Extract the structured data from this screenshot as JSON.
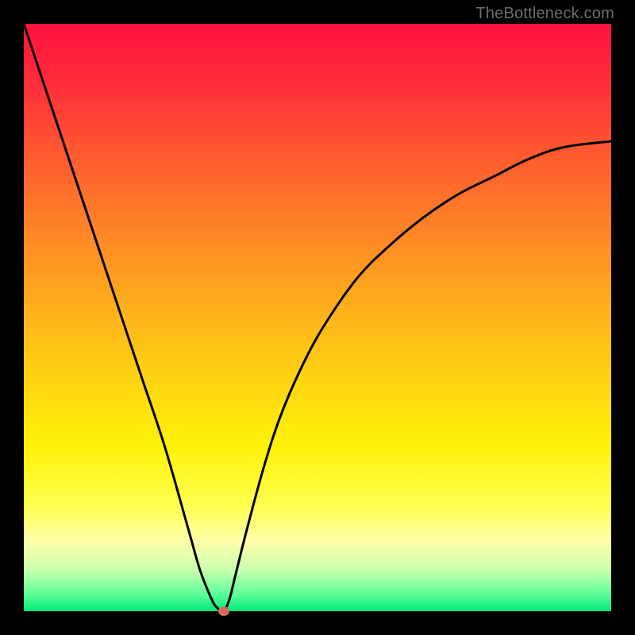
{
  "watermark": {
    "text": "TheBottleneck.com"
  },
  "chart_data": {
    "type": "line",
    "title": "",
    "xlabel": "",
    "ylabel": "",
    "xlim": [
      0,
      100
    ],
    "ylim": [
      0,
      100
    ],
    "grid": false,
    "legend": false,
    "background_gradient": {
      "stops": [
        {
          "offset": 0.0,
          "color": "#ff113f"
        },
        {
          "offset": 0.1,
          "color": "#ff2d3a"
        },
        {
          "offset": 0.22,
          "color": "#ff5930"
        },
        {
          "offset": 0.35,
          "color": "#ff8426"
        },
        {
          "offset": 0.48,
          "color": "#ffae1c"
        },
        {
          "offset": 0.6,
          "color": "#ffd212"
        },
        {
          "offset": 0.72,
          "color": "#fff208"
        },
        {
          "offset": 0.82,
          "color": "#ffff50"
        },
        {
          "offset": 0.88,
          "color": "#ffffa8"
        },
        {
          "offset": 0.93,
          "color": "#c8ffb0"
        },
        {
          "offset": 0.97,
          "color": "#60ff9a"
        },
        {
          "offset": 1.0,
          "color": "#00e878"
        }
      ]
    },
    "series": [
      {
        "name": "bottleneck-curve",
        "type": "line",
        "color": "#000000",
        "stroke_width": 3,
        "x": [
          0,
          4,
          8,
          12,
          16,
          20,
          24,
          28,
          30,
          32,
          33,
          34,
          35,
          36,
          38,
          41,
          44,
          48,
          52,
          57,
          62,
          68,
          74,
          80,
          86,
          92,
          100
        ],
        "y": [
          100,
          88,
          76,
          64,
          52,
          40,
          28,
          14,
          7,
          2,
          0.5,
          0,
          2,
          6,
          14,
          25,
          34,
          43,
          50,
          57,
          62,
          67,
          71,
          74,
          77,
          79,
          80
        ]
      }
    ],
    "markers": [
      {
        "name": "min-point",
        "x": 34,
        "y": 0,
        "color": "#d36a5a"
      }
    ]
  }
}
